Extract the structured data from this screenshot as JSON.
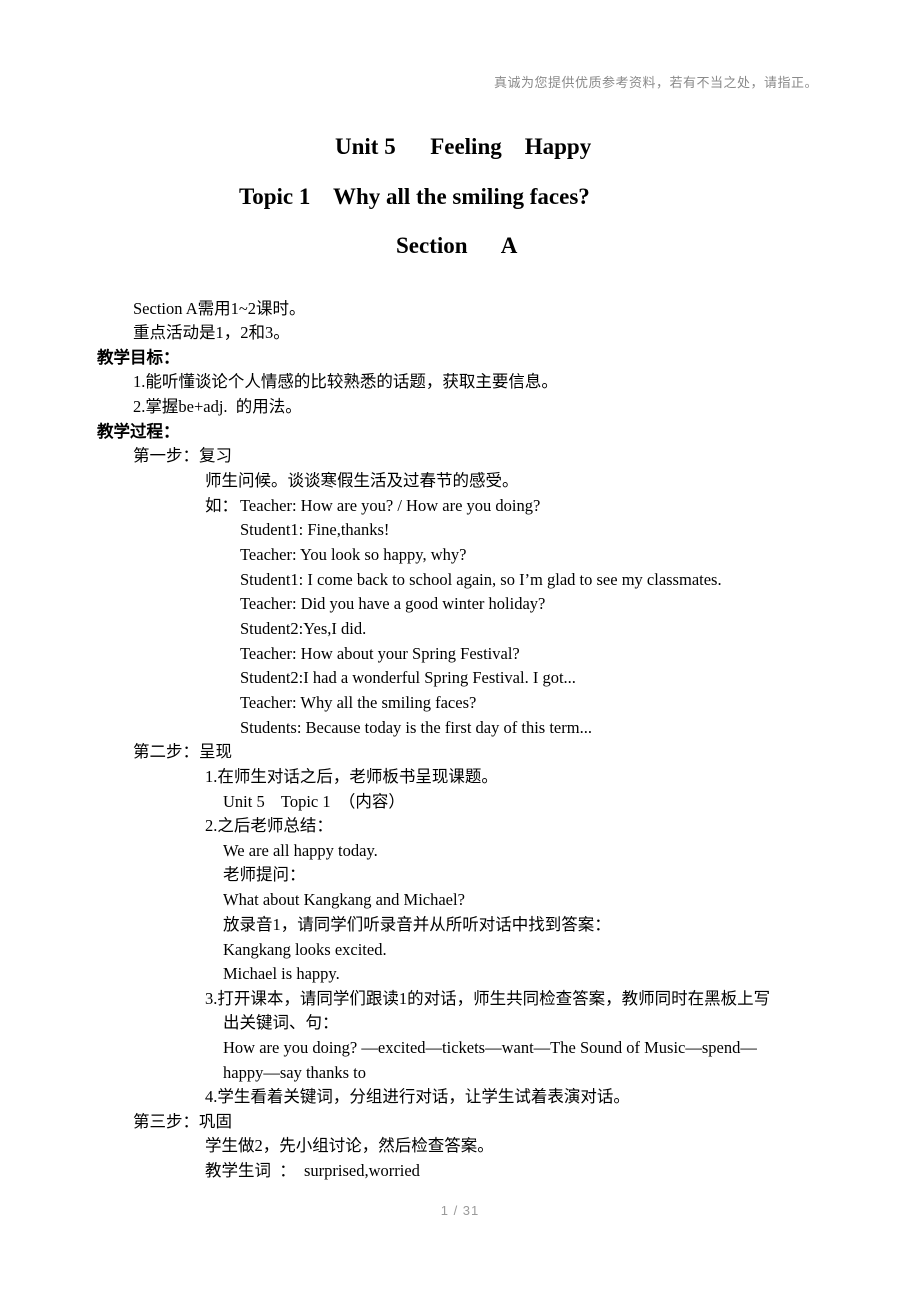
{
  "header_note": "真诚为您提供优质参考资料，若有不当之处，请指正。",
  "titles": {
    "unit": "Unit 5      Feeling    Happy",
    "topic": "Topic 1    Why all the smiling faces?",
    "section": "Section      A"
  },
  "intro": [
    "Section A需用1~2课时。",
    "重点活动是1，2和3。"
  ],
  "objectives": {
    "heading": "教学目标：",
    "items": [
      "1.能听懂谈论个人情感的比较熟悉的话题，获取主要信息。",
      "2.掌握be+adj.  的用法。"
    ]
  },
  "process": {
    "heading": "教学过程：",
    "step1": {
      "label": "第一步：复习",
      "desc": "师生问候。谈谈寒假生活及过春节的感受。",
      "example_prefix": "如：",
      "dialogue": [
        "Teacher: How are you? / How are you doing?",
        "Student1: Fine,thanks!",
        "Teacher: You look so happy, why?",
        "Student1: I come back to school again, so I’m glad to see my classmates.",
        "Teacher: Did you have a good winter holiday?",
        "Student2:Yes,I did.",
        "Teacher: How about your Spring Festival?",
        "Student2:I had a wonderful Spring Festival. I got...",
        "Teacher: Why all the smiling faces?",
        "Students: Because today is the first day of this term..."
      ]
    },
    "step2": {
      "label": "第二步：呈现",
      "lines": [
        "1.在师生对话之后，老师板书呈现课题。",
        "Unit 5    Topic 1  （内容）",
        "2.之后老师总结：",
        "We are all happy today.",
        "老师提问：",
        "What about Kangkang and Michael?",
        "放录音1，请同学们听录音并从所听对话中找到答案：",
        "Kangkang looks excited.",
        "Michael is happy.",
        "3.打开课本，请同学们跟读1的对话，师生共同检查答案，教师同时在黑板上写",
        "出关键词、句：",
        "How are you doing? —excited—tickets—want—The Sound of Music—spend—",
        "happy—say thanks to",
        "4.学生看着关键词，分组进行对话，让学生试着表演对话。"
      ]
    },
    "step3": {
      "label": "第三步：巩固",
      "lines": [
        "学生做2，先小组讨论，然后检查答案。",
        "教学生词  ：  surprised,worried"
      ]
    }
  },
  "footer": {
    "page_indicator": "1 / 31"
  }
}
